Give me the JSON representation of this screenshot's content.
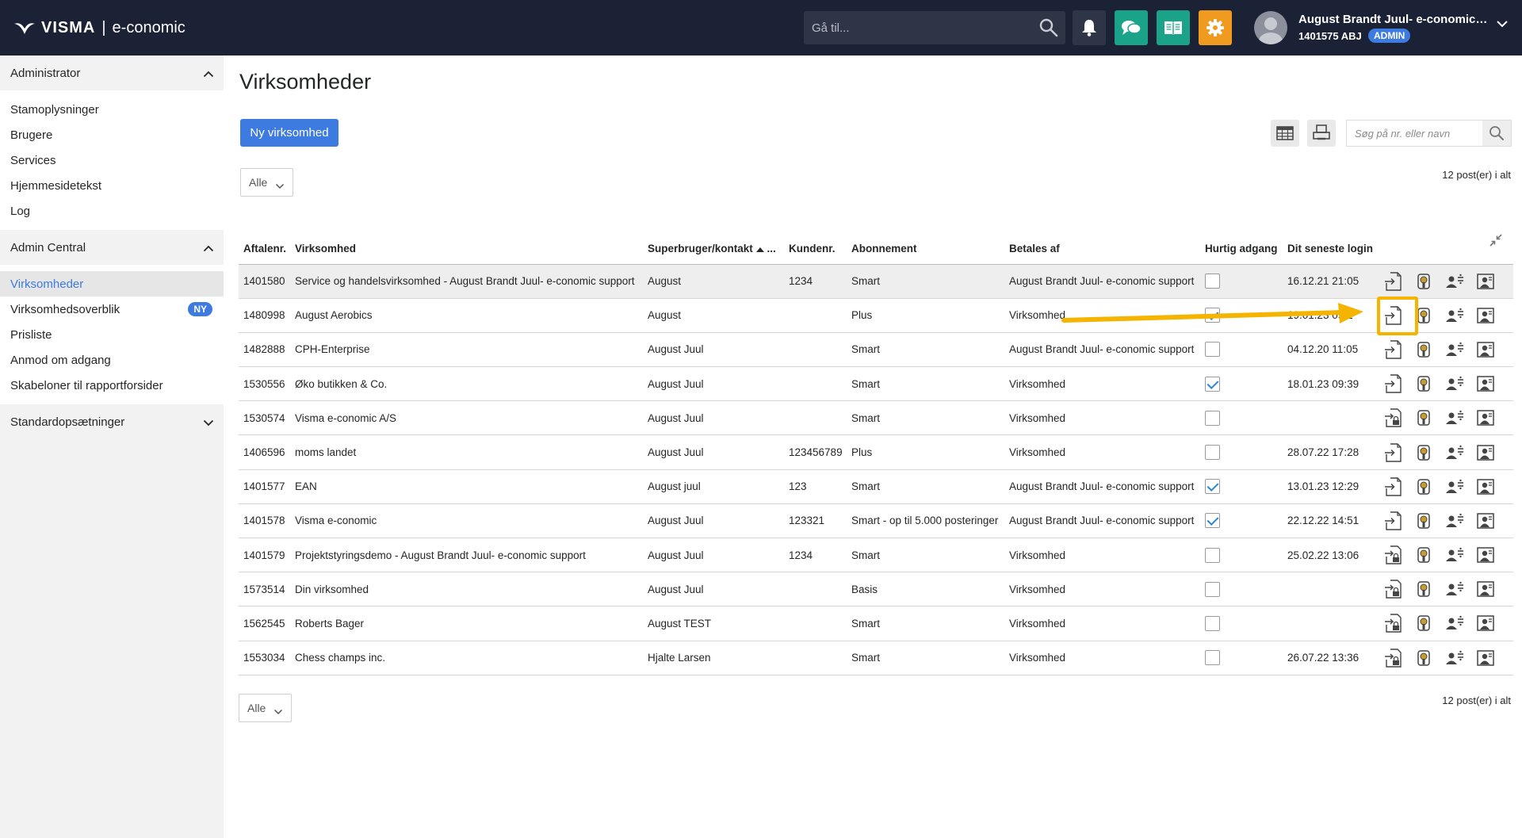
{
  "header": {
    "brand": "VISMA",
    "separator": "|",
    "product": "e-conomic",
    "goto_placeholder": "Gå til...",
    "user_name": "August Brandt Juul- e-conomic s...",
    "user_id": "1401575 ABJ",
    "admin_badge": "ADMIN"
  },
  "sidebar": {
    "sections": [
      {
        "title": "Administrator",
        "items": [
          {
            "label": "Stamoplysninger"
          },
          {
            "label": "Brugere"
          },
          {
            "label": "Services"
          },
          {
            "label": "Hjemmesidetekst"
          },
          {
            "label": "Log"
          }
        ]
      },
      {
        "title": "Admin Central",
        "items": [
          {
            "label": "Virksomheder"
          },
          {
            "label": "Virksomhedsoverblik",
            "badge": "NY"
          },
          {
            "label": "Prisliste"
          },
          {
            "label": "Anmod om adgang"
          },
          {
            "label": "Skabeloner til rapportforsider"
          }
        ]
      },
      {
        "title": "Standardopsætninger"
      }
    ]
  },
  "main": {
    "title": "Virksomheder",
    "new_button": "Ny virksomhed",
    "search_placeholder": "Søg på nr. eller navn",
    "filter_value": "Alle",
    "post_count": "12 post(er) i alt",
    "columns": [
      "Aftalenr.",
      "Virksomhed",
      "Superbruger/kontakt",
      "Kundenr.",
      "Abonnement",
      "Betales af",
      "Hurtig adgang",
      "Dit seneste login"
    ],
    "column_ellipsis": "...",
    "rows": [
      {
        "aftalenr": "1401580",
        "virksomhed": "Service og handelsvirksomhed - August Brandt Juul- e-conomic support",
        "kontakt": "August",
        "kundenr": "1234",
        "abonnement": "Smart",
        "betales_af": "August Brandt Juul- e-conomic support",
        "hurtig": false,
        "login": "16.12.21 21:05"
      },
      {
        "aftalenr": "1480998",
        "virksomhed": "August Aerobics",
        "kontakt": "August",
        "kundenr": "",
        "abonnement": "Plus",
        "betales_af": "Virksomhed",
        "hurtig": true,
        "login": "19.01.23 09:1"
      },
      {
        "aftalenr": "1482888",
        "virksomhed": "CPH-Enterprise",
        "kontakt": "August Juul",
        "kundenr": "",
        "abonnement": "Smart",
        "betales_af": "August Brandt Juul- e-conomic support",
        "hurtig": false,
        "login": "04.12.20 11:05"
      },
      {
        "aftalenr": "1530556",
        "virksomhed": "Øko butikken & Co.",
        "kontakt": "August Juul",
        "kundenr": "",
        "abonnement": "Smart",
        "betales_af": "Virksomhed",
        "hurtig": true,
        "login": "18.01.23 09:39"
      },
      {
        "aftalenr": "1530574",
        "virksomhed": "Visma e-conomic A/S",
        "kontakt": "August Juul",
        "kundenr": "",
        "abonnement": "Smart",
        "betales_af": "Virksomhed",
        "hurtig": false,
        "login": ""
      },
      {
        "aftalenr": "1406596",
        "virksomhed": "moms landet",
        "kontakt": "August Juul",
        "kundenr": "123456789",
        "abonnement": "Plus",
        "betales_af": "Virksomhed",
        "hurtig": false,
        "login": "28.07.22 17:28"
      },
      {
        "aftalenr": "1401577",
        "virksomhed": "EAN",
        "kontakt": "August juul",
        "kundenr": "123",
        "abonnement": "Smart",
        "betales_af": "August Brandt Juul- e-conomic support",
        "hurtig": true,
        "login": "13.01.23 12:29"
      },
      {
        "aftalenr": "1401578",
        "virksomhed": "Visma e-conomic",
        "kontakt": "August Juul",
        "kundenr": "123321",
        "abonnement": "Smart - op til 5.000 posteringer",
        "betales_af": "August Brandt Juul- e-conomic support",
        "hurtig": true,
        "login": "22.12.22 14:51"
      },
      {
        "aftalenr": "1401579",
        "virksomhed": "Projektstyringsdemo - August Brandt Juul- e-conomic support",
        "kontakt": "August Juul",
        "kundenr": "1234",
        "abonnement": "Smart",
        "betales_af": "Virksomhed",
        "hurtig": false,
        "login": "25.02.22 13:06"
      },
      {
        "aftalenr": "1573514",
        "virksomhed": "Din virksomhed",
        "kontakt": "August Juul",
        "kundenr": "",
        "abonnement": "Basis",
        "betales_af": "Virksomhed",
        "hurtig": false,
        "login": ""
      },
      {
        "aftalenr": "1562545",
        "virksomhed": "Roberts Bager",
        "kontakt": "August TEST",
        "kundenr": "",
        "abonnement": "Smart",
        "betales_af": "Virksomhed",
        "hurtig": false,
        "login": ""
      },
      {
        "aftalenr": "1553034",
        "virksomhed": "Chess champs inc.",
        "kontakt": "Hjalte Larsen",
        "kundenr": "",
        "abonnement": "Smart",
        "betales_af": "Virksomhed",
        "hurtig": false,
        "login": "26.07.22 13:36"
      }
    ]
  },
  "colors": {
    "topbar": "#1b2235",
    "accent": "#3e7be0",
    "teal": "#1ba38a",
    "orange": "#f19a20",
    "highlight": "#f5b400"
  },
  "icons": {
    "row_actions": [
      "login-icon",
      "key-icon",
      "user-assign-icon",
      "user-card-icon"
    ]
  }
}
